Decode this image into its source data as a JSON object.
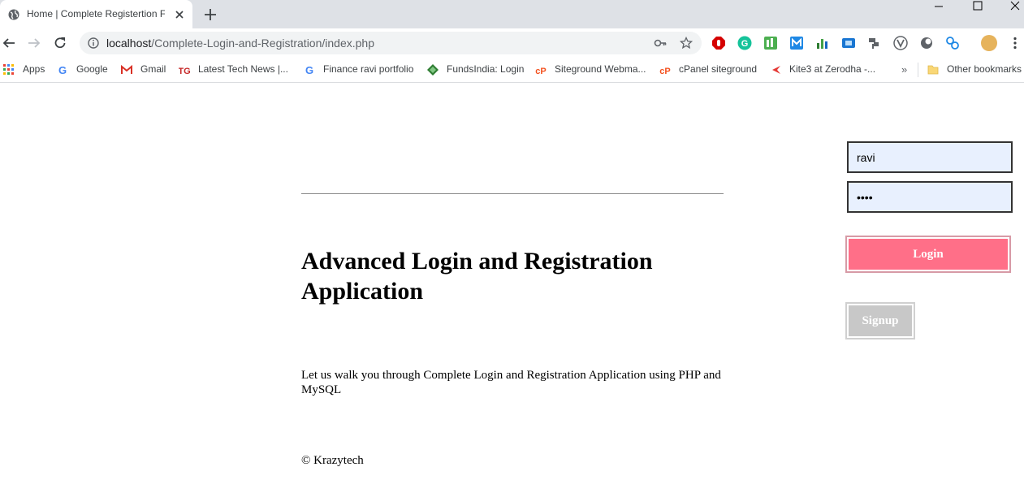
{
  "browser": {
    "tab": {
      "title": "Home | Complete Registertion Fr"
    },
    "url": {
      "host": "localhost",
      "path": "/Complete-Login-and-Registration/index.php"
    },
    "bookmarks": [
      {
        "label": "Apps",
        "icon": "apps-grid-icon"
      },
      {
        "label": "Google",
        "icon": "google-icon"
      },
      {
        "label": "Gmail",
        "icon": "gmail-icon"
      },
      {
        "label": "Latest Tech News |...",
        "icon": "tg-icon"
      },
      {
        "label": "Finance ravi portfolio",
        "icon": "google-icon"
      },
      {
        "label": "FundsIndia: Login",
        "icon": "fundsindia-icon"
      },
      {
        "label": "Siteground Webma...",
        "icon": "cpanel-icon"
      },
      {
        "label": "cPanel siteground",
        "icon": "cpanel-icon"
      },
      {
        "label": "Kite3 at Zerodha -...",
        "icon": "kite-icon"
      }
    ],
    "bookmarks_more": "»",
    "other_bookmarks": "Other bookmarks"
  },
  "page": {
    "heading": "Advanced Login and Registration Application",
    "description": "Let us walk you through Complete Login and Registration Application using PHP and MySQL",
    "copyright": "© Krazytech"
  },
  "login_form": {
    "username_value": "ravi",
    "password_value": "••••",
    "login_label": "Login",
    "signup_label": "Signup"
  },
  "colors": {
    "login_button": "#ff6f88",
    "signup_button": "#c8c8c8",
    "input_background": "#e8f0fe"
  }
}
